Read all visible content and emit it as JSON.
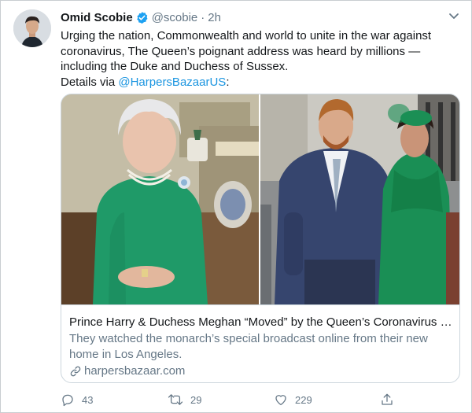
{
  "tweet": {
    "author_name": "Omid Scobie",
    "handle": "@scobie",
    "separator": "·",
    "time": "2h",
    "text_lines": [
      "Urging the nation, Commonwealth and world to unite in the war against",
      "coronavirus, The Queen’s poignant address was heard by millions —",
      "including the Duke and Duchess of Sussex."
    ],
    "details_prefix": "Details via ",
    "details_mention": "@HarpersBazaarUS",
    "details_suffix": ":"
  },
  "card": {
    "title": "Prince Harry & Duchess Meghan “Moved” by the Queen’s Coronavirus Speech",
    "description": "They watched the monarch’s special broadcast online from their new home in Los Angeles.",
    "domain": "harpersbazaar.com"
  },
  "actions": {
    "replies": "43",
    "retweets": "29",
    "likes": "229"
  },
  "colors": {
    "link": "#1b95e0",
    "muted": "#657786",
    "verified": "#1da1f2",
    "queen_dress": "#1f9a68",
    "wall": "#b9b29a"
  },
  "icons": [
    "verified-badge-icon",
    "chevron-down-icon",
    "link-icon",
    "reply-icon",
    "retweet-icon",
    "like-icon",
    "share-icon"
  ]
}
